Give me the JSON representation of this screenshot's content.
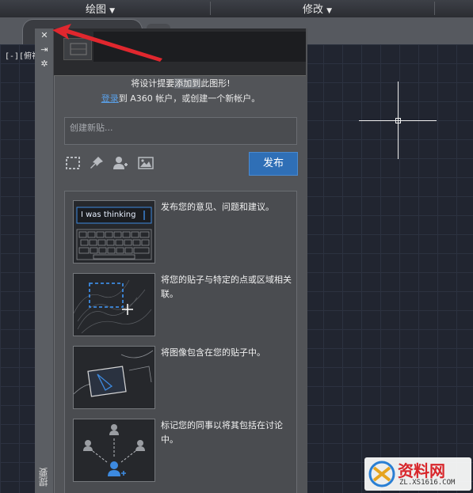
{
  "ribbon": {
    "draw_label": "绘图",
    "modify_label": "修改",
    "dropdown_glyph": "▼"
  },
  "viewport": {
    "label": "[-][俯视"
  },
  "palette": {
    "close_glyph": "✕",
    "autohide_glyph": "⇥",
    "settings_glyph": "✲",
    "title": "提要",
    "notice_line1_pre": "将设计提要",
    "notice_line1_hl": "添加到",
    "notice_line1_post": "此图形!",
    "notice_login_link": "登录",
    "notice_line2_rest": "到 A360 帐户，或创建一个新帐户。",
    "new_post_placeholder": "创建新贴...",
    "tools": {
      "select_area": "⬚",
      "pin": "📌",
      "add_user": "👤",
      "image": "🖼"
    },
    "publish_label": "发布",
    "tips": [
      {
        "text": "发布您的意见、问题和建议。",
        "mock_input": "I was thinking"
      },
      {
        "text": "将您的贴子与特定的点或区域相关联。"
      },
      {
        "text": "将图像包含在您的贴子中。"
      },
      {
        "text": "标记您的同事以将其包括在讨论中。"
      }
    ]
  },
  "watermark": {
    "title": "资料网",
    "url": "ZL.XS1616.COM"
  },
  "colors": {
    "accent": "#2f6fb6",
    "arrow": "#e0272e",
    "link": "#5aa0e8"
  }
}
